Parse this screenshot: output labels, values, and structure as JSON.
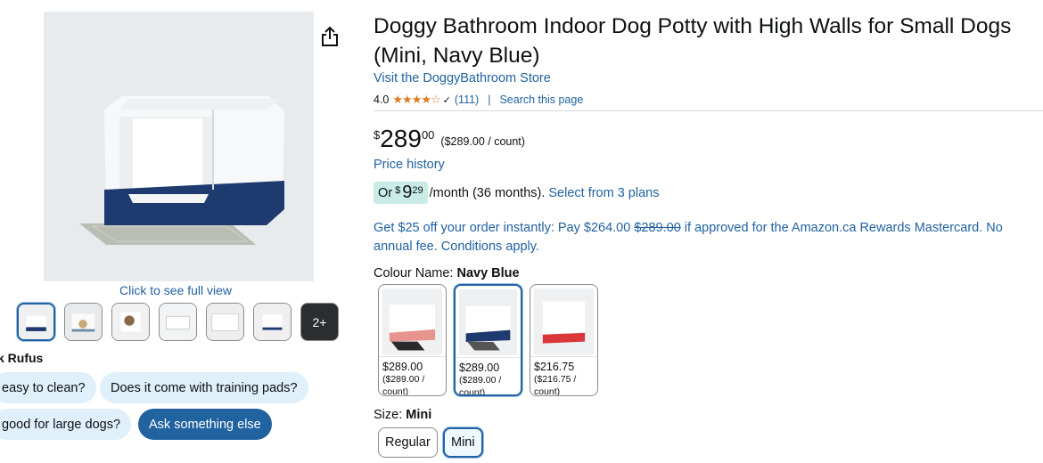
{
  "gallery": {
    "full_view_label": "Click to see full view",
    "more_label": "2+"
  },
  "rufus": {
    "label": "k Rufus",
    "chips": [
      "easy to clean?",
      "Does it come with training pads?",
      "good for large dogs?",
      "Ask something else"
    ]
  },
  "product": {
    "title": "Doggy Bathroom Indoor Dog Potty with High Walls for Small Dogs (Mini, Navy Blue)",
    "store_link": "Visit the DoggyBathroom Store",
    "rating_value": "4.0",
    "rating_stars": 4.0,
    "rating_count": "(111)",
    "separator": "|",
    "search_page": "Search this page"
  },
  "price": {
    "symbol": "$",
    "whole": "289",
    "fraction": "00",
    "unit": "($289.00 / count)",
    "history_link": "Price history"
  },
  "installment": {
    "prefix": "Or",
    "symbol": "$",
    "whole": "9",
    "fraction": "29",
    "text": "/month (36 months).",
    "link": "Select from 3 plans"
  },
  "promo": {
    "before": "Get $25 off your order instantly: Pay $264.00 ",
    "struck": "$289.00",
    "after": " if approved for the Amazon.ca Rewards Mastercard. No annual fee. Conditions apply."
  },
  "colour": {
    "label": "Colour Name:",
    "selected": "Navy Blue",
    "options": [
      {
        "price": "$289.00",
        "per_line1": "($289.00 /",
        "per_line2": "count)",
        "accent": "#e8948e"
      },
      {
        "price": "$289.00",
        "per_line1": "($289.00 /",
        "per_line2": "count)",
        "accent": "#1f3a6e"
      },
      {
        "price": "$216.75",
        "per_line1": "($216.75 /",
        "per_line2": "count)",
        "accent": "#d9373a"
      }
    ]
  },
  "size": {
    "label": "Size:",
    "selected": "Mini",
    "options": [
      "Regular",
      "Mini"
    ]
  },
  "colors": {
    "link": "#2162a1",
    "star": "#de7921",
    "chip_bg": "#dff0fb",
    "chip_dark_bg": "#2162a1",
    "deal_bg": "#c9ece8",
    "navy_base": "#1f3a6e"
  },
  "icons": {
    "share": "share-icon",
    "chevron": "chevron-down-icon",
    "stars": "star-icon"
  }
}
